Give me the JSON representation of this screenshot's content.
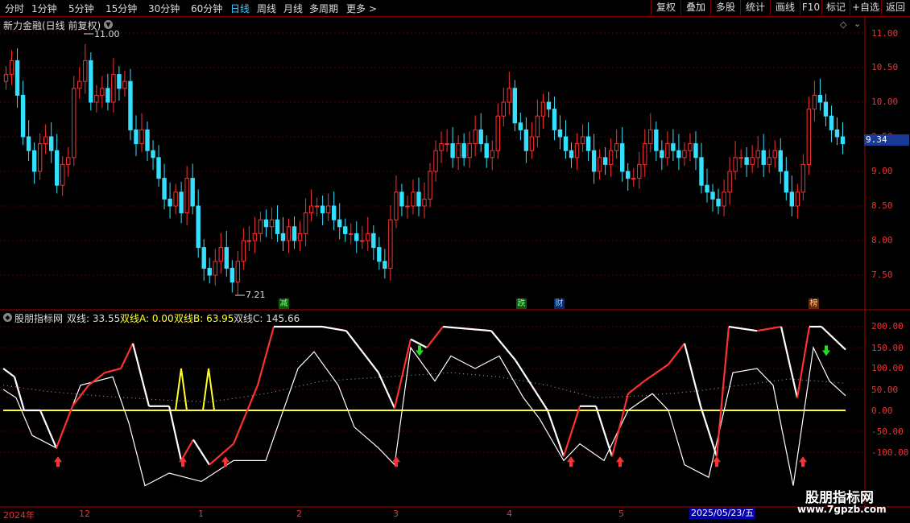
{
  "toolbar": {
    "tabs": [
      "分时",
      "1分钟",
      "5分钟",
      "15分钟",
      "30分钟",
      "60分钟",
      "日线",
      "周线",
      "月线",
      "多周期",
      "更多 >"
    ],
    "active_tab": "日线",
    "right_buttons": [
      "复权",
      "叠加",
      "多股",
      "统计",
      "画线",
      "F10",
      "标记",
      "+自选",
      "返回"
    ]
  },
  "main_chart": {
    "title": "新力金融(日线 前复权)",
    "y_ticks": [
      "11.00",
      "10.50",
      "10.00",
      "9.50",
      "9.00",
      "8.50",
      "8.00",
      "7.50"
    ],
    "current_price": "9.34",
    "high_label": "11.00",
    "low_label": "7.21",
    "event_tags": [
      "减",
      "跌",
      "财",
      "榜"
    ]
  },
  "indicator": {
    "name": "股朋指标网",
    "line_label": "双线: 33.55",
    "a_label": "双线A: 0.00",
    "b_label": "双线B: 63.95",
    "c_label": "双线C: 145.66",
    "y_ticks": [
      "200.00",
      "150.00",
      "100.00",
      "50.00",
      "0.00",
      "-50.00",
      "-100.00"
    ]
  },
  "date_axis": {
    "labels": [
      "2024年",
      "12",
      "1",
      "2",
      "3",
      "4",
      "5"
    ],
    "cursor_date": "2025/05/23/五"
  },
  "watermark": {
    "title": "股朋指标网",
    "url": "www.7gpzb.com"
  },
  "colors": {
    "up": "#ff3030",
    "down": "#33e0ff",
    "yellow": "#ffff30",
    "grid": "#7a0000"
  }
}
